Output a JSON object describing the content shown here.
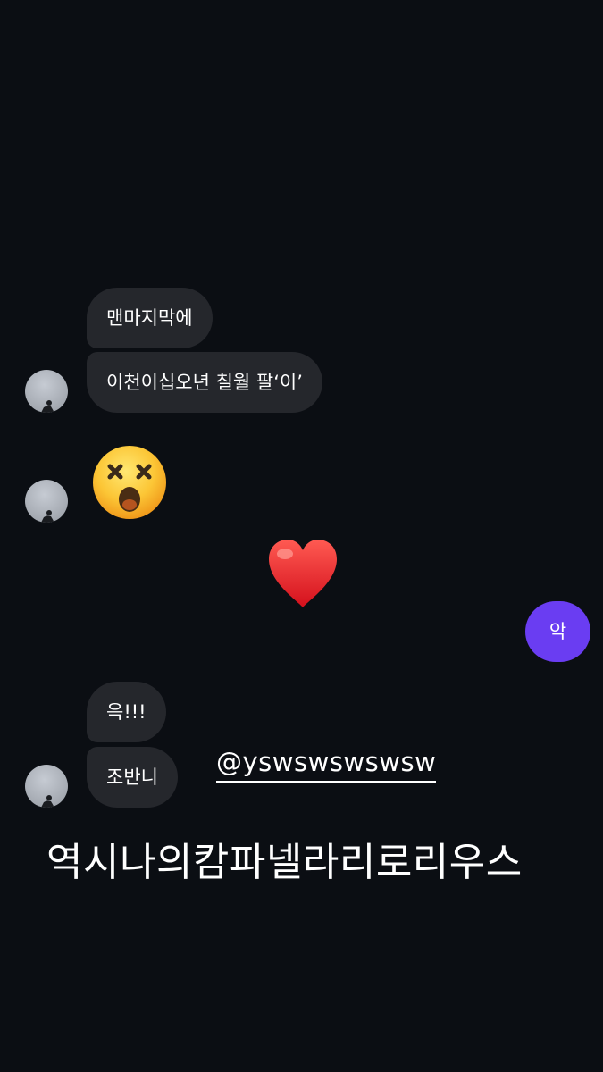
{
  "messages": {
    "group1": {
      "bubble1": "맨마지막에",
      "bubble2": "이천이십오년 칠월 팔‘이’"
    },
    "outgoing": {
      "bubble1": "악"
    },
    "group3": {
      "bubble1": "윽!!!",
      "bubble2": "조반니"
    }
  },
  "emojis": {
    "dizzy_face": "dizzy-face-emoji",
    "red_heart": "red-heart-emoji"
  },
  "stickers": {
    "handle": "@yswswswswsw"
  },
  "caption": "역시나의캄파넬라리로리우스",
  "colors": {
    "background": "#0b0e13",
    "incoming_bubble": "#25272c",
    "outgoing_bubble": "#6a3df2"
  }
}
